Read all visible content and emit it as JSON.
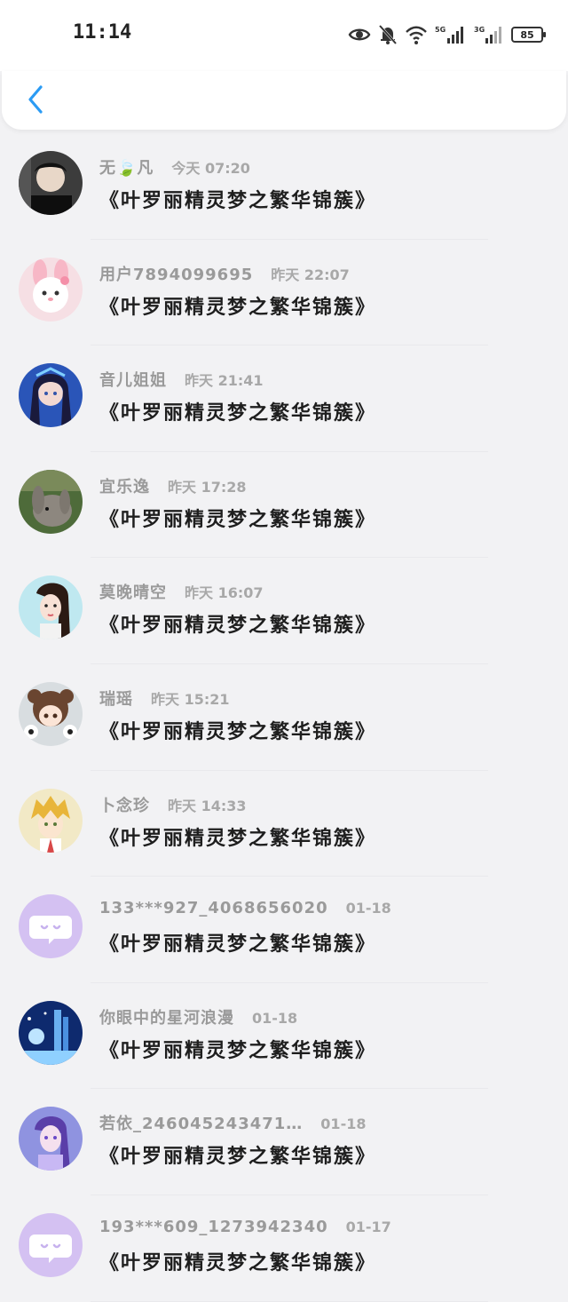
{
  "status_bar": {
    "time": "11:14",
    "icons": [
      "eye-icon",
      "mute-bell-icon",
      "wifi-icon",
      "signal-5g-icon",
      "signal-3g-icon"
    ],
    "network_labels": [
      "5G",
      "3G"
    ],
    "battery": "85"
  },
  "nav": {
    "back_icon": "chevron-left-icon",
    "accent": "#2b9bf4"
  },
  "comments": [
    {
      "user": "无🍃凡",
      "time": "今天 07:20",
      "book": "《叶罗丽精灵梦之繁华锦簇》",
      "avatar": "photo-boy"
    },
    {
      "user": "用户7894099695",
      "time": "昨天 22:07",
      "book": "《叶罗丽精灵梦之繁华锦簇》",
      "avatar": "pink-bunny"
    },
    {
      "user": "音儿姐姐",
      "time": "昨天 21:41",
      "book": "《叶罗丽精灵梦之繁华锦簇》",
      "avatar": "anime-girl-blue"
    },
    {
      "user": "宜乐逸",
      "time": "昨天 17:28",
      "book": "《叶罗丽精灵梦之繁华锦簇》",
      "avatar": "rabbit"
    },
    {
      "user": "莫晚晴空",
      "time": "昨天 16:07",
      "book": "《叶罗丽精灵梦之繁华锦簇》",
      "avatar": "drawn-girl"
    },
    {
      "user": "瑞瑶",
      "time": "昨天 15:21",
      "book": "《叶罗丽精灵梦之繁华锦簇》",
      "avatar": "chibi-girl"
    },
    {
      "user": "卜念珍",
      "time": "昨天 14:33",
      "book": "《叶罗丽精灵梦之繁华锦簇》",
      "avatar": "anime-boy-blond"
    },
    {
      "user": "133***927_4068656020",
      "time": "01-18",
      "book": "《叶罗丽精灵梦之繁华锦簇》",
      "avatar": "default-chat"
    },
    {
      "user": "你眼中的星河浪漫",
      "time": "01-18",
      "book": "《叶罗丽精灵梦之繁华锦簇》",
      "avatar": "blue-scene"
    },
    {
      "user": "若依_246045243471…",
      "time": "01-18",
      "book": "《叶罗丽精灵梦之繁华锦簇》",
      "avatar": "purple-fairy"
    },
    {
      "user": "193***609_1273942340",
      "time": "01-17",
      "book": "《叶罗丽精灵梦之繁华锦簇》",
      "avatar": "default-chat"
    }
  ]
}
